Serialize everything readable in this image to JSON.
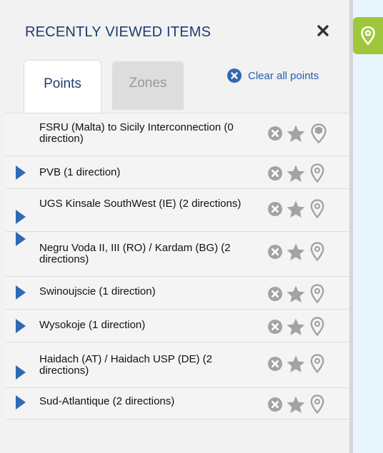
{
  "panel": {
    "title": "RECENTLY VIEWED ITEMS",
    "close_icon": "close-icon",
    "tabs": [
      {
        "label": "Points",
        "active": true
      },
      {
        "label": "Zones",
        "active": false
      }
    ],
    "clear_all_label": "Clear all points"
  },
  "items": [
    {
      "label": "FSRU (Malta) to Sicily Interconnection (0 direction)",
      "expandable": false
    },
    {
      "label": "PVB (1 direction)",
      "expandable": true
    },
    {
      "label": "UGS Kinsale SouthWest (IE) (2 directions)",
      "expandable": true
    },
    {
      "label": "Negru Voda II, III (RO) / Kardam (BG) (2 directions)",
      "expandable": true
    },
    {
      "label": "Swinoujscie (1 direction)",
      "expandable": true
    },
    {
      "label": "Wysokoje (1 direction)",
      "expandable": true
    },
    {
      "label": "Haidach (AT) / Haidach USP (DE) (2 directions)",
      "expandable": true
    },
    {
      "label": "Sud-Atlantique (2 directions)",
      "expandable": true
    }
  ],
  "item_actions": [
    "remove-icon",
    "star-icon",
    "map-pin-icon"
  ],
  "colors": {
    "title": "#1f3c73",
    "accent_blue": "#2f6ab2",
    "link_blue": "#1f5fb0",
    "map_tab": "#9fc73c",
    "action_gray": "#a3a3a3"
  }
}
